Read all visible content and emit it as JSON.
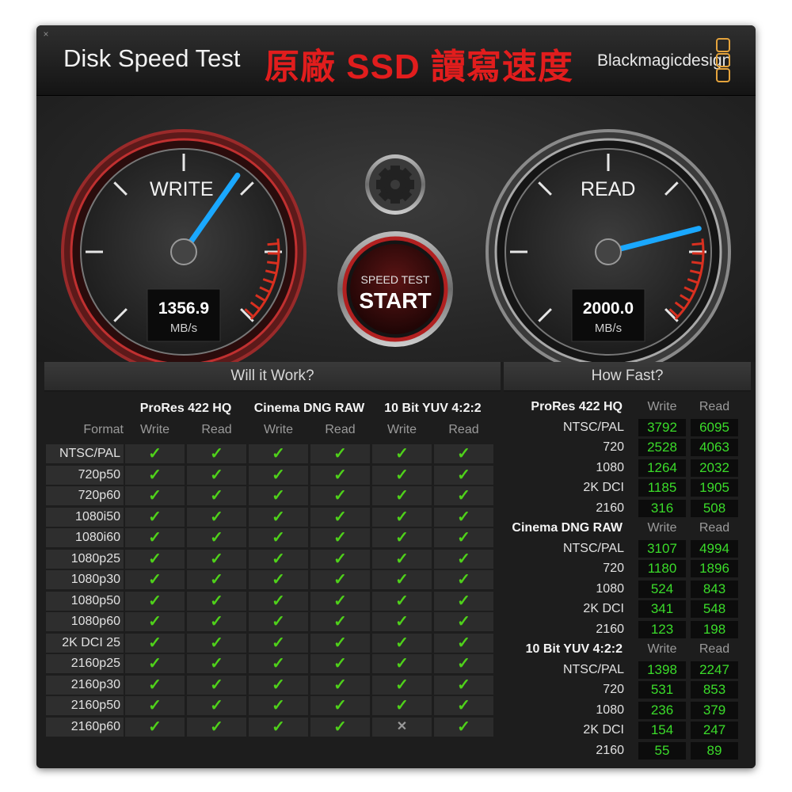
{
  "window": {
    "app_title": "Disk Speed Test",
    "overlay_title": "原廠 SSD 讀寫速度",
    "brand": "Blackmagicdesign",
    "close_icon": "close-icon"
  },
  "gauges": {
    "write": {
      "label": "WRITE",
      "value": "1356.9",
      "unit": "MB/s",
      "needle_fraction": 0.63
    },
    "read": {
      "label": "READ",
      "value": "2000.0",
      "unit": "MB/s",
      "needle_fraction": 0.78
    }
  },
  "controls": {
    "settings_icon": "gear-icon",
    "start_sub": "SPEED TEST",
    "start_label": "START"
  },
  "will_it_work": {
    "title": "Will it Work?",
    "format_header": "Format",
    "groups": [
      "ProRes 422 HQ",
      "Cinema DNG RAW",
      "10 Bit YUV 4:2:2"
    ],
    "col_headers": [
      "Write",
      "Read",
      "Write",
      "Read",
      "Write",
      "Read"
    ],
    "rows": [
      {
        "format": "NTSC/PAL",
        "cells": [
          "check",
          "check",
          "check",
          "check",
          "check",
          "check"
        ]
      },
      {
        "format": "720p50",
        "cells": [
          "check",
          "check",
          "check",
          "check",
          "check",
          "check"
        ]
      },
      {
        "format": "720p60",
        "cells": [
          "check",
          "check",
          "check",
          "check",
          "check",
          "check"
        ]
      },
      {
        "format": "1080i50",
        "cells": [
          "check",
          "check",
          "check",
          "check",
          "check",
          "check"
        ]
      },
      {
        "format": "1080i60",
        "cells": [
          "check",
          "check",
          "check",
          "check",
          "check",
          "check"
        ]
      },
      {
        "format": "1080p25",
        "cells": [
          "check",
          "check",
          "check",
          "check",
          "check",
          "check"
        ]
      },
      {
        "format": "1080p30",
        "cells": [
          "check",
          "check",
          "check",
          "check",
          "check",
          "check"
        ]
      },
      {
        "format": "1080p50",
        "cells": [
          "check",
          "check",
          "check",
          "check",
          "check",
          "check"
        ]
      },
      {
        "format": "1080p60",
        "cells": [
          "check",
          "check",
          "check",
          "check",
          "check",
          "check"
        ]
      },
      {
        "format": "2K DCI 25",
        "cells": [
          "check",
          "check",
          "check",
          "check",
          "check",
          "check"
        ]
      },
      {
        "format": "2160p25",
        "cells": [
          "check",
          "check",
          "check",
          "check",
          "check",
          "check"
        ]
      },
      {
        "format": "2160p30",
        "cells": [
          "check",
          "check",
          "check",
          "check",
          "check",
          "check"
        ]
      },
      {
        "format": "2160p50",
        "cells": [
          "check",
          "check",
          "check",
          "check",
          "check",
          "check"
        ]
      },
      {
        "format": "2160p60",
        "cells": [
          "check",
          "check",
          "check",
          "check",
          "cross",
          "check"
        ]
      }
    ],
    "symbols": {
      "check": "✓",
      "cross": "✕"
    }
  },
  "how_fast": {
    "title": "How Fast?",
    "col_write": "Write",
    "col_read": "Read",
    "groups": [
      {
        "name": "ProRes 422 HQ",
        "rows": [
          {
            "label": "NTSC/PAL",
            "write": "3792",
            "read": "6095"
          },
          {
            "label": "720",
            "write": "2528",
            "read": "4063"
          },
          {
            "label": "1080",
            "write": "1264",
            "read": "2032"
          },
          {
            "label": "2K DCI",
            "write": "1185",
            "read": "1905"
          },
          {
            "label": "2160",
            "write": "316",
            "read": "508"
          }
        ]
      },
      {
        "name": "Cinema DNG RAW",
        "rows": [
          {
            "label": "NTSC/PAL",
            "write": "3107",
            "read": "4994"
          },
          {
            "label": "720",
            "write": "1180",
            "read": "1896"
          },
          {
            "label": "1080",
            "write": "524",
            "read": "843"
          },
          {
            "label": "2K DCI",
            "write": "341",
            "read": "548"
          },
          {
            "label": "2160",
            "write": "123",
            "read": "198"
          }
        ]
      },
      {
        "name": "10 Bit YUV 4:2:2",
        "rows": [
          {
            "label": "NTSC/PAL",
            "write": "1398",
            "read": "2247"
          },
          {
            "label": "720",
            "write": "531",
            "read": "853"
          },
          {
            "label": "1080",
            "write": "236",
            "read": "379"
          },
          {
            "label": "2K DCI",
            "write": "154",
            "read": "247"
          },
          {
            "label": "2160",
            "write": "55",
            "read": "89"
          }
        ]
      }
    ]
  }
}
